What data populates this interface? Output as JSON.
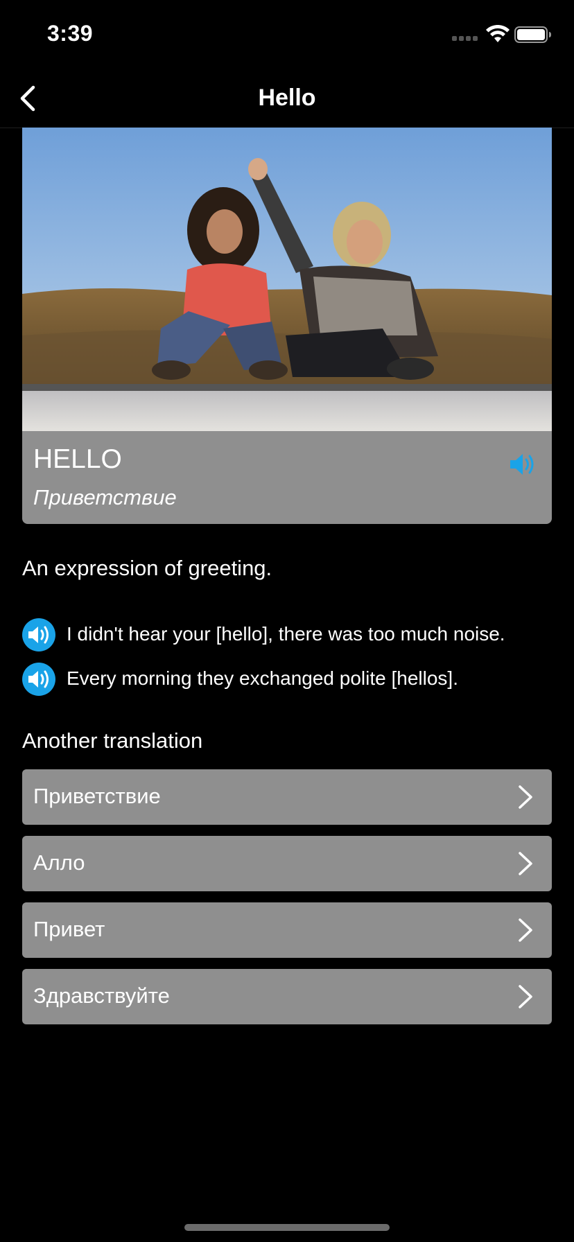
{
  "status_bar": {
    "time": "3:39"
  },
  "nav": {
    "title": "Hello",
    "back_icon": "chevron-left-icon"
  },
  "word_card": {
    "word": "HELLO",
    "translation": "Приветствие",
    "speaker_icon": "speaker-icon",
    "accent_color": "#1aa3e8"
  },
  "definition": "An expression of greeting.",
  "examples": [
    {
      "text": "I didn't hear your [hello], there was too much noise."
    },
    {
      "text": "Every morning they exchanged polite [hellos]."
    }
  ],
  "another_translation": {
    "heading": "Another translation",
    "items": [
      {
        "label": "Приветствие"
      },
      {
        "label": "Алло"
      },
      {
        "label": "Привет"
      },
      {
        "label": "Здравствуйте"
      }
    ]
  }
}
